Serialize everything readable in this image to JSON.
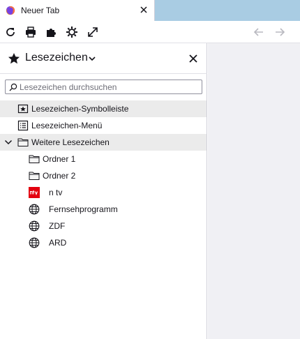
{
  "tab": {
    "title": "Neuer Tab",
    "favicon": "firefox-icon"
  },
  "toolbar": {
    "buttons": [
      "reload-icon",
      "print-icon",
      "extensions-icon",
      "settings-icon",
      "fullscreen-icon"
    ],
    "back_icon": "arrow-left-icon",
    "forward_icon": "arrow-right-icon"
  },
  "sidebar": {
    "title": "Lesezeichen",
    "search_placeholder": "Lesezeichen durchsuchen",
    "items": [
      {
        "label": "Lesezeichen-Symbolleiste",
        "icon": "bookmarks-toolbar-icon",
        "selected": true
      },
      {
        "label": "Lesezeichen-Menü",
        "icon": "bookmarks-menu-icon",
        "selected": false
      },
      {
        "label": "Weitere Lesezeichen",
        "icon": "folder-icon",
        "selected": true,
        "expanded": true,
        "children": [
          {
            "label": "Ordner 1",
            "icon": "folder-icon"
          },
          {
            "label": "Ordner 2",
            "icon": "folder-icon"
          },
          {
            "label": "n tv",
            "icon": "ntv-favicon"
          },
          {
            "label": "Fernsehprogramm",
            "icon": "globe-icon"
          },
          {
            "label": "ZDF",
            "icon": "globe-icon"
          },
          {
            "label": "ARD",
            "icon": "globe-icon"
          }
        ]
      }
    ]
  },
  "colors": {
    "tabstrip": "#a9cce3",
    "selected_row": "#ebebeb",
    "content_bg": "#f0f0f4",
    "ntv_red": "#e3000f"
  }
}
